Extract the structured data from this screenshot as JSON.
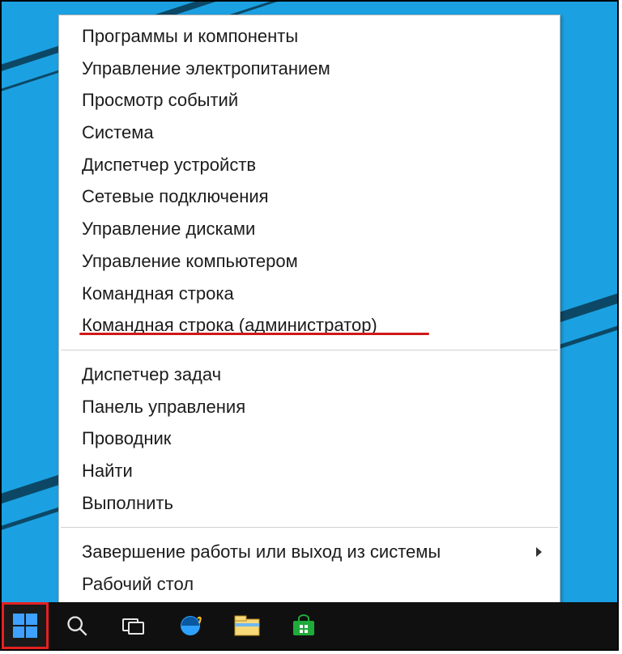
{
  "menu": {
    "groups": [
      [
        {
          "label": "Программы и компоненты"
        },
        {
          "label": "Управление электропитанием"
        },
        {
          "label": "Просмотр событий"
        },
        {
          "label": "Система"
        },
        {
          "label": "Диспетчер устройств"
        },
        {
          "label": "Сетевые подключения"
        },
        {
          "label": "Управление дисками"
        },
        {
          "label": "Управление компьютером"
        },
        {
          "label": "Командная строка"
        },
        {
          "label": "Командная строка (администратор)",
          "highlighted": true
        }
      ],
      [
        {
          "label": "Диспетчер задач"
        },
        {
          "label": "Панель управления"
        },
        {
          "label": "Проводник"
        },
        {
          "label": "Найти"
        },
        {
          "label": "Выполнить"
        }
      ],
      [
        {
          "label": "Завершение работы или выход из системы",
          "submenu": true
        },
        {
          "label": "Рабочий стол"
        }
      ]
    ]
  },
  "taskbar": {
    "items": [
      {
        "name": "start-button",
        "icon": "windows-logo-icon",
        "highlighted": true
      },
      {
        "name": "search-button",
        "icon": "search-icon"
      },
      {
        "name": "task-view-button",
        "icon": "task-view-icon"
      },
      {
        "name": "ie-button",
        "icon": "internet-explorer-icon"
      },
      {
        "name": "file-explorer-button",
        "icon": "file-explorer-icon"
      },
      {
        "name": "store-button",
        "icon": "store-icon"
      }
    ]
  },
  "colors": {
    "accent": "#1ba1e2",
    "highlight_border": "#e52020",
    "underline": "#d01818"
  }
}
